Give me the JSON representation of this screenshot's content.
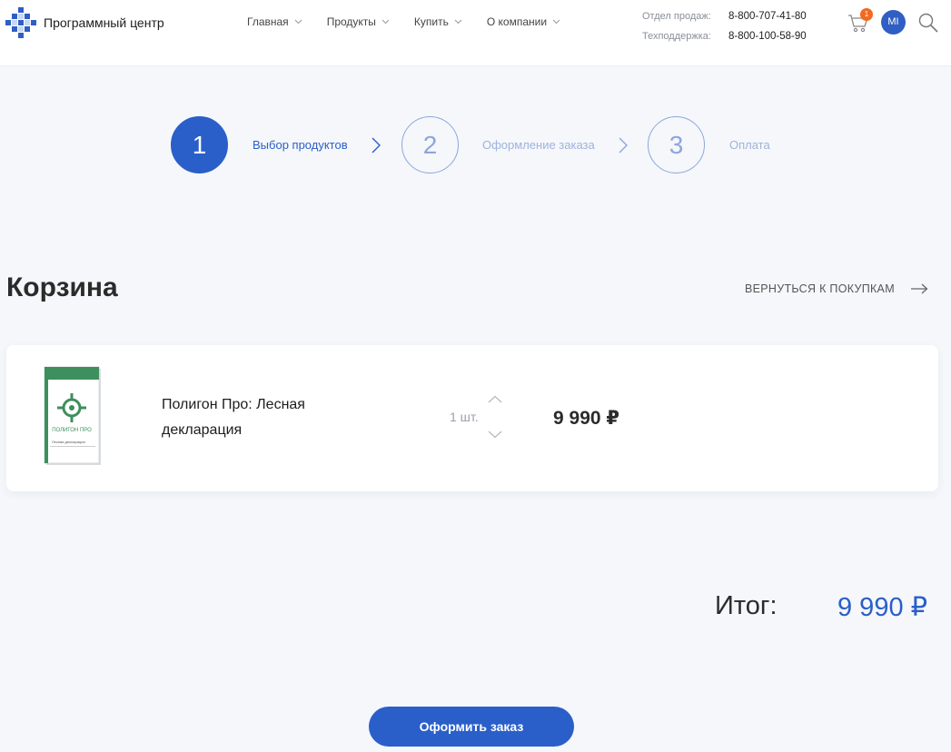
{
  "header": {
    "logo_text": "Программный центр",
    "nav": [
      {
        "label": "Главная"
      },
      {
        "label": "Продукты"
      },
      {
        "label": "Купить"
      },
      {
        "label": "О компании"
      }
    ],
    "contacts": [
      {
        "label": "Отдел продаж:",
        "phone": "8-800-707-41-80"
      },
      {
        "label": "Техподдержка:",
        "phone": "8-800-100-58-90"
      }
    ],
    "cart_count": "1",
    "user_initials": "MI",
    "accent_color": "#2a5fc9",
    "badge_color": "#f26a21"
  },
  "steps": [
    {
      "number": "1",
      "label": "Выбор продуктов",
      "state": "active"
    },
    {
      "number": "2",
      "label": "Оформление заказа",
      "state": "inactive"
    },
    {
      "number": "3",
      "label": "Оплата",
      "state": "inactive"
    }
  ],
  "cart": {
    "title": "Корзина",
    "back_link": "ВЕРНУТЬСЯ К ПОКУПКАМ",
    "items": [
      {
        "name": "Полигон Про: Лесная декларация",
        "box_brand": "ПОЛИГОН ПРО",
        "box_subtitle": "Лесная декларация",
        "quantity": "1 шт.",
        "price": "9 990 ₽"
      }
    ]
  },
  "total": {
    "label": "Итог:",
    "value": "9 990 ₽"
  },
  "order_button": "Оформить заказ"
}
